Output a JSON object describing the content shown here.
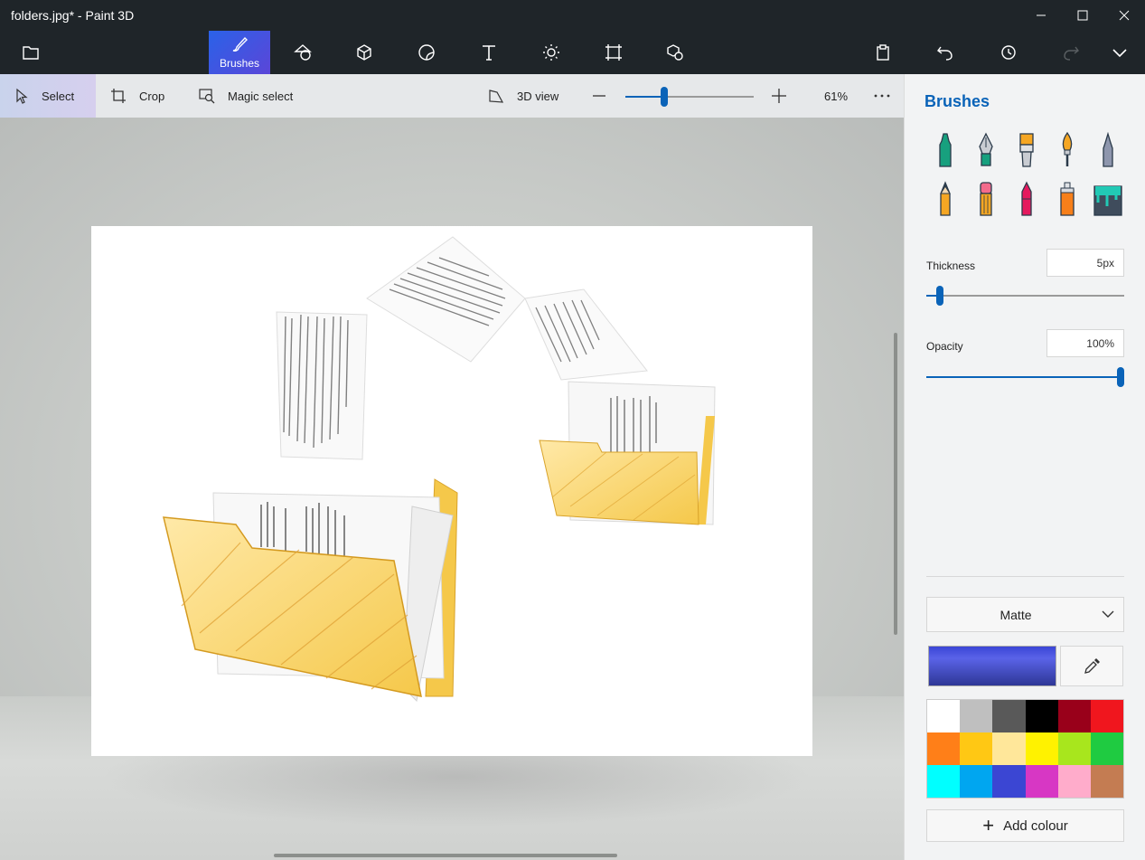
{
  "window": {
    "title": "folders.jpg* - Paint 3D"
  },
  "toolbar": {
    "brushes_label": "Brushes",
    "tools": [
      "2d-shapes-icon",
      "3d-shapes-icon",
      "stickers-icon",
      "text-icon",
      "effects-icon",
      "canvas-icon",
      "3d-library-icon"
    ],
    "right_tools": [
      "paste-icon",
      "undo-icon",
      "history-icon",
      "redo-icon",
      "expand-icon"
    ]
  },
  "subtoolbar": {
    "select_label": "Select",
    "crop_label": "Crop",
    "magic_select_label": "Magic select",
    "view3d_label": "3D view",
    "zoom_level": "61%",
    "zoom_fraction": 0.29
  },
  "panel": {
    "title": "Brushes",
    "brushes_row1": [
      "marker-icon",
      "calligraphy-pen-icon",
      "oil-brush-icon",
      "watercolor-icon",
      "pixel-pen-icon"
    ],
    "brushes_row2": [
      "pencil-icon",
      "eraser-icon",
      "crayon-icon",
      "spray-can-icon",
      "fill-bucket-icon"
    ],
    "thickness_label": "Thickness",
    "thickness_value": "5px",
    "thickness_fraction": 0.05,
    "opacity_label": "Opacity",
    "opacity_value": "100%",
    "opacity_fraction": 1.0,
    "finish_label": "Matte",
    "current_color": "#3a45d6",
    "palette": [
      "#ffffff",
      "#bfbfbf",
      "#595959",
      "#000000",
      "#99001a",
      "#f0161e",
      "#ff7f18",
      "#ffc814",
      "#ffe79a",
      "#fff200",
      "#a8e61d",
      "#1fcb41",
      "#00ffff",
      "#00a6f0",
      "#3b46d3",
      "#d737c4",
      "#ffaccb",
      "#c47c52"
    ],
    "add_colour_label": "Add colour"
  },
  "colors": {
    "accent": "#0a63b8",
    "titlebar": "#1f2529"
  }
}
